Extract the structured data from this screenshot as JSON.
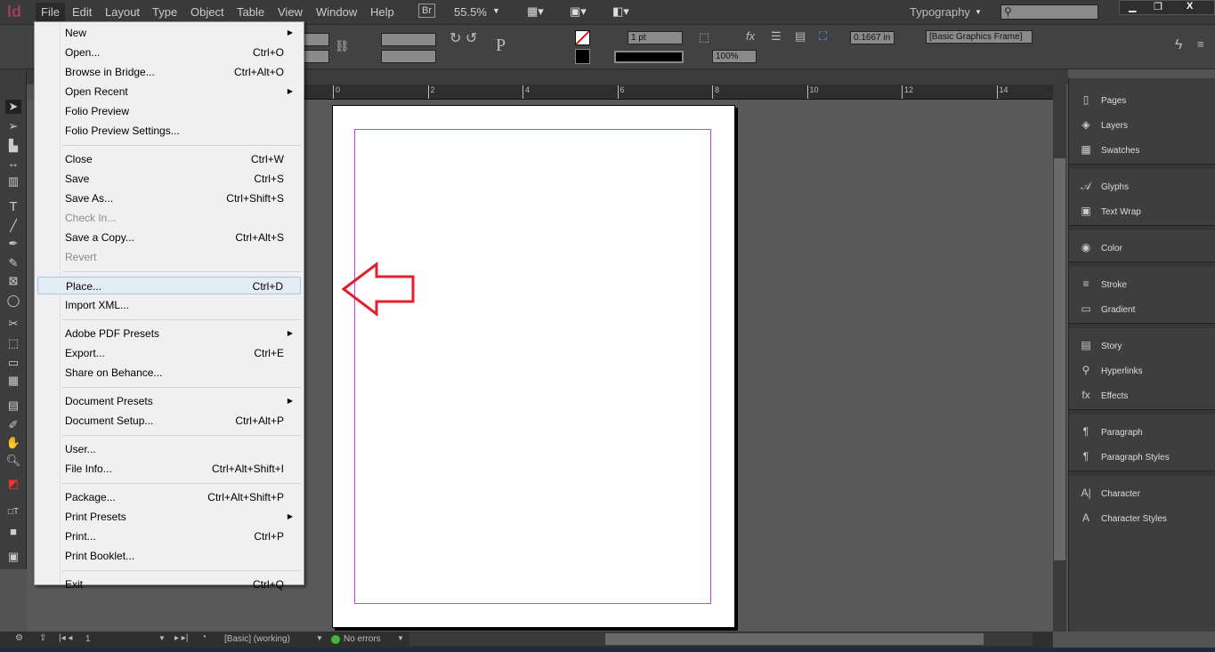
{
  "app": {
    "logo": "Id",
    "zoom": "55.5%",
    "bridge": "Br",
    "workspace": "Typography",
    "search_placeholder": ""
  },
  "menubar": [
    "File",
    "Edit",
    "Layout",
    "Type",
    "Object",
    "Table",
    "View",
    "Window",
    "Help"
  ],
  "control": {
    "stroke_weight": "1 pt",
    "opacity": "100%",
    "offset": "0.1667 in",
    "object_style": "[Basic Graphics Frame]"
  },
  "ruler": [
    "0",
    "2",
    "4",
    "6",
    "8",
    "10",
    "12",
    "14"
  ],
  "file_menu": [
    {
      "label": "New",
      "submenu": true
    },
    {
      "label": "Open...",
      "shortcut": "Ctrl+O"
    },
    {
      "label": "Browse in Bridge...",
      "shortcut": "Ctrl+Alt+O"
    },
    {
      "label": "Open Recent",
      "submenu": true
    },
    {
      "label": "Folio Preview"
    },
    {
      "label": "Folio Preview Settings..."
    },
    {
      "sep": true
    },
    {
      "label": "Close",
      "shortcut": "Ctrl+W"
    },
    {
      "label": "Save",
      "shortcut": "Ctrl+S"
    },
    {
      "label": "Save As...",
      "shortcut": "Ctrl+Shift+S"
    },
    {
      "label": "Check In...",
      "disabled": true
    },
    {
      "label": "Save a Copy...",
      "shortcut": "Ctrl+Alt+S"
    },
    {
      "label": "Revert",
      "disabled": true
    },
    {
      "sep": true
    },
    {
      "label": "Place...",
      "shortcut": "Ctrl+D",
      "highlighted": true
    },
    {
      "label": "Import XML..."
    },
    {
      "sep": true
    },
    {
      "label": "Adobe PDF Presets",
      "submenu": true
    },
    {
      "label": "Export...",
      "shortcut": "Ctrl+E"
    },
    {
      "label": "Share on Behance..."
    },
    {
      "sep": true
    },
    {
      "label": "Document Presets",
      "submenu": true
    },
    {
      "label": "Document Setup...",
      "shortcut": "Ctrl+Alt+P"
    },
    {
      "sep": true
    },
    {
      "label": "User..."
    },
    {
      "label": "File Info...",
      "shortcut": "Ctrl+Alt+Shift+I"
    },
    {
      "sep": true
    },
    {
      "label": "Package...",
      "shortcut": "Ctrl+Alt+Shift+P"
    },
    {
      "label": "Print Presets",
      "submenu": true
    },
    {
      "label": "Print...",
      "shortcut": "Ctrl+P"
    },
    {
      "label": "Print Booklet..."
    },
    {
      "sep": true
    },
    {
      "label": "Exit",
      "shortcut": "Ctrl+Q"
    }
  ],
  "panels": [
    [
      {
        "label": "Pages",
        "icon": "pages-icon"
      },
      {
        "label": "Layers",
        "icon": "layers-icon"
      },
      {
        "label": "Swatches",
        "icon": "swatches-icon"
      }
    ],
    [
      {
        "label": "Glyphs",
        "icon": "glyphs-icon"
      },
      {
        "label": "Text Wrap",
        "icon": "text-wrap-icon"
      }
    ],
    [
      {
        "label": "Color",
        "icon": "color-icon"
      }
    ],
    [
      {
        "label": "Stroke",
        "icon": "stroke-icon"
      },
      {
        "label": "Gradient",
        "icon": "gradient-icon"
      }
    ],
    [
      {
        "label": "Story",
        "icon": "story-icon"
      },
      {
        "label": "Hyperlinks",
        "icon": "hyperlinks-icon"
      },
      {
        "label": "Effects",
        "icon": "effects-icon"
      }
    ],
    [
      {
        "label": "Paragraph",
        "icon": "paragraph-icon"
      },
      {
        "label": "Paragraph Styles",
        "icon": "paragraph-styles-icon"
      }
    ],
    [
      {
        "label": "Character",
        "icon": "character-icon"
      },
      {
        "label": "Character Styles",
        "icon": "character-styles-icon"
      }
    ]
  ],
  "status": {
    "page": "1",
    "style": "[Basic] (working)",
    "preflight": "No errors"
  },
  "colors": {
    "arrow": "#e0202a",
    "margin_guide": "#c040ff",
    "preflight_ok": "#3cb83c"
  }
}
